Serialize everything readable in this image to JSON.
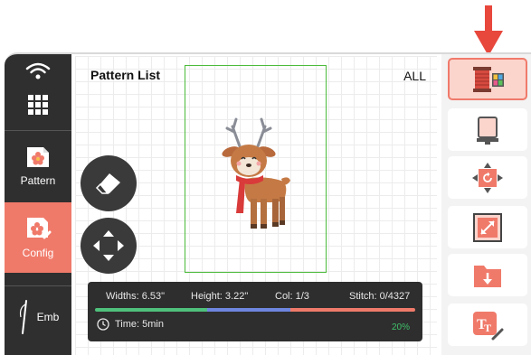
{
  "sidebar": {
    "items": [
      {
        "id": "grid",
        "label": "",
        "icon": "grid-menu-icon"
      },
      {
        "id": "pattern",
        "label": "Pattern",
        "icon": "pattern-flower-icon"
      },
      {
        "id": "config",
        "label": "Config",
        "icon": "config-edit-icon",
        "active": true
      },
      {
        "id": "emb",
        "label": "Emb",
        "icon": "needle-icon"
      }
    ],
    "wifi_icon": "wifi-icon"
  },
  "canvas": {
    "title": "Pattern List",
    "filter": "ALL"
  },
  "info": {
    "width": "Widths: 6.53\"",
    "height": "Height: 3.22\"",
    "color": "Col: 1/3",
    "stitch": "Stitch: 0/4327",
    "time": "Time: 5min",
    "percent": "20%",
    "progress_segments": [
      {
        "color": "#4fc17c",
        "fraction": 0.35
      },
      {
        "color": "#6f86e0",
        "fraction": 0.26
      },
      {
        "color": "#f07a6a",
        "fraction": 0.39
      }
    ]
  },
  "tools": [
    {
      "id": "thread",
      "icon": "thread-spool-icon",
      "active": true
    },
    {
      "id": "frame",
      "icon": "embroidery-frame-icon"
    },
    {
      "id": "rotate",
      "icon": "rotate-icon"
    },
    {
      "id": "scale",
      "icon": "resize-icon"
    },
    {
      "id": "import",
      "icon": "folder-import-icon"
    },
    {
      "id": "text",
      "icon": "text-edit-icon"
    }
  ],
  "colors": {
    "accent": "#f07a6a",
    "sidebar_bg": "#2f2f2f",
    "hoop_outline": "#4cbb3c",
    "progress_green": "#4fc17c",
    "progress_blue": "#6f86e0",
    "pointer_arrow": "#e8473c"
  }
}
